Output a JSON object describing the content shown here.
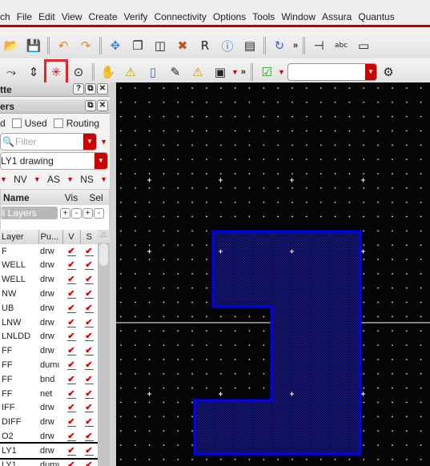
{
  "menu": [
    "ch",
    "File",
    "Edit",
    "View",
    "Create",
    "Verify",
    "Connectivity",
    "Options",
    "Tools",
    "Window",
    "Assura",
    "Quantus"
  ],
  "toolbar1": [
    {
      "icon": "open-folder-icon",
      "g": "📂"
    },
    {
      "icon": "save-icon",
      "g": "💾"
    },
    {
      "icon": "undo-icon",
      "g": "↶"
    },
    {
      "icon": "redo-icon",
      "g": "↷"
    },
    {
      "icon": "move-icon",
      "g": "✥"
    },
    {
      "icon": "copy-icon",
      "g": "❐"
    },
    {
      "icon": "stretch-icon",
      "g": "◫"
    },
    {
      "icon": "delete-icon",
      "g": "✖"
    },
    {
      "icon": "replace-icon",
      "g": "R"
    },
    {
      "icon": "info-icon",
      "g": "ⓘ"
    },
    {
      "icon": "align-icon",
      "g": "▤"
    },
    {
      "icon": "rotate-icon",
      "g": "↻"
    }
  ],
  "toolbar1_more": "»",
  "toolbar1_right": [
    {
      "icon": "create-pin-icon",
      "g": "⊣"
    },
    {
      "icon": "label-icon",
      "g": "abc"
    },
    {
      "icon": "instance-icon",
      "g": "▭"
    }
  ],
  "toolbar2": [
    {
      "icon": "wire-route-icon",
      "g": "⤳"
    },
    {
      "icon": "layer-stack-icon",
      "g": "⇕"
    },
    {
      "icon": "starburst-icon",
      "g": "✳",
      "highlight": true
    },
    {
      "icon": "select-shapes-icon",
      "g": "⊙"
    },
    {
      "icon": "stop-hand-icon",
      "g": "✋"
    },
    {
      "icon": "warning-icon",
      "g": "⚠"
    },
    {
      "icon": "yellow-marker-icon",
      "g": "▯"
    },
    {
      "icon": "edit-layers-icon",
      "g": "✎"
    },
    {
      "icon": "warning-explosion-icon",
      "g": "⚠"
    },
    {
      "icon": "shape-tools-icon",
      "g": "▣"
    }
  ],
  "toolbar2_more": "»",
  "toolbar2_check": {
    "icon": "chip-check-icon",
    "g": "☑"
  },
  "toolbar2_combo_value": "",
  "palette": {
    "title": "tte"
  },
  "layers": {
    "title": "ers",
    "filters": [
      {
        "label": "d",
        "checked": false
      },
      {
        "label": "Used",
        "checked": false
      },
      {
        "label": "Routing",
        "checked": false
      }
    ],
    "filter_placeholder": "Filter",
    "current_layer": "LY1 drawing",
    "vis_options": [
      "NV",
      "AS",
      "NS"
    ],
    "header": {
      "name": "Name",
      "vis": "Vis",
      "sel": "Sel"
    },
    "all_layers": "ll Layers",
    "columns": [
      "Layer",
      "Pu...",
      "V",
      "S"
    ],
    "rows": [
      {
        "layer": "F",
        "purpose": "drw"
      },
      {
        "layer": "WELL",
        "purpose": "drw"
      },
      {
        "layer": "WELL",
        "purpose": "drw"
      },
      {
        "layer": "NW",
        "purpose": "drw"
      },
      {
        "layer": "UB",
        "purpose": "drw"
      },
      {
        "layer": "LNW",
        "purpose": "drw"
      },
      {
        "layer": "LNLDD",
        "purpose": "drw"
      },
      {
        "layer": "FF",
        "purpose": "drw"
      },
      {
        "layer": "FF",
        "purpose": "dumı"
      },
      {
        "layer": "FF",
        "purpose": "bnd"
      },
      {
        "layer": "FF",
        "purpose": "net"
      },
      {
        "layer": "IFF",
        "purpose": "drw"
      },
      {
        "layer": "DIFF",
        "purpose": "drw"
      },
      {
        "layer": "O2",
        "purpose": "drw"
      },
      {
        "layer": "LY1",
        "purpose": "drw",
        "selected": true
      },
      {
        "layer": "LY1",
        "purpose": "dumı"
      },
      {
        "layer": "",
        "purpose": ""
      }
    ]
  },
  "colors": {
    "accent": "#c00000",
    "shape_outline": "#0000ff",
    "canvas": "#050505",
    "highlight": "#e8232a"
  }
}
